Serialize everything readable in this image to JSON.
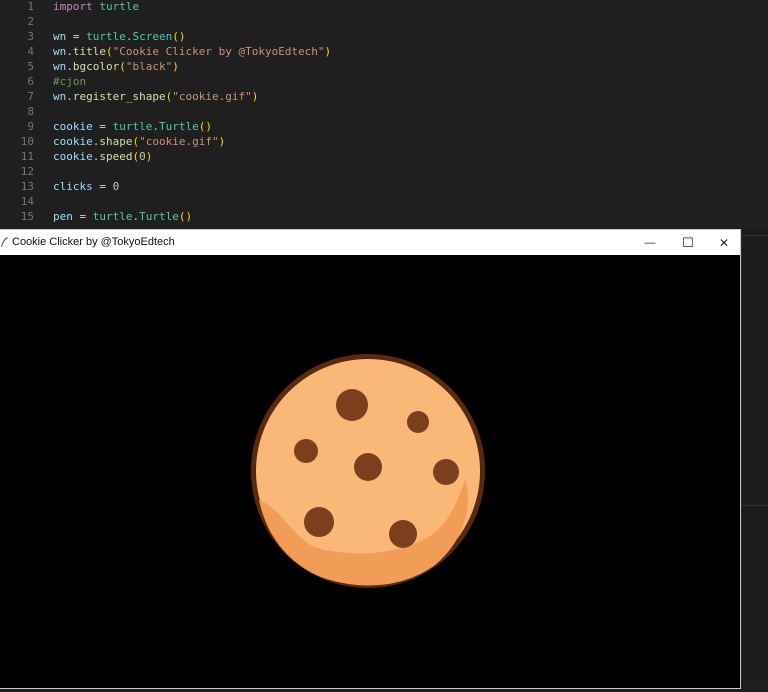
{
  "editor": {
    "lines": [
      {
        "n": "1",
        "tokens": [
          {
            "c": "kw",
            "t": "import"
          },
          {
            "c": "code",
            "t": " "
          },
          {
            "c": "mod",
            "t": "turtle"
          }
        ]
      },
      {
        "n": "2",
        "tokens": []
      },
      {
        "n": "3",
        "tokens": [
          {
            "c": "var",
            "t": "wn"
          },
          {
            "c": "op",
            "t": " = "
          },
          {
            "c": "mod",
            "t": "turtle"
          },
          {
            "c": "code",
            "t": "."
          },
          {
            "c": "mod",
            "t": "Screen"
          },
          {
            "c": "pn",
            "t": "()"
          }
        ]
      },
      {
        "n": "4",
        "tokens": [
          {
            "c": "var",
            "t": "wn"
          },
          {
            "c": "code",
            "t": "."
          },
          {
            "c": "fn",
            "t": "title"
          },
          {
            "c": "pn",
            "t": "("
          },
          {
            "c": "str",
            "t": "\"Cookie Clicker by @TokyoEdtech\""
          },
          {
            "c": "pn",
            "t": ")"
          }
        ]
      },
      {
        "n": "5",
        "tokens": [
          {
            "c": "var",
            "t": "wn"
          },
          {
            "c": "code",
            "t": "."
          },
          {
            "c": "fn",
            "t": "bgcolor"
          },
          {
            "c": "pn",
            "t": "("
          },
          {
            "c": "str",
            "t": "\"black\""
          },
          {
            "c": "pn",
            "t": ")"
          }
        ]
      },
      {
        "n": "6",
        "tokens": [
          {
            "c": "cm",
            "t": "#cjon"
          }
        ]
      },
      {
        "n": "7",
        "tokens": [
          {
            "c": "var",
            "t": "wn"
          },
          {
            "c": "code",
            "t": "."
          },
          {
            "c": "fn",
            "t": "register_shape"
          },
          {
            "c": "pn",
            "t": "("
          },
          {
            "c": "str",
            "t": "\"cookie.gif\""
          },
          {
            "c": "pn",
            "t": ")"
          }
        ]
      },
      {
        "n": "8",
        "tokens": []
      },
      {
        "n": "9",
        "tokens": [
          {
            "c": "var",
            "t": "cookie"
          },
          {
            "c": "op",
            "t": " = "
          },
          {
            "c": "mod",
            "t": "turtle"
          },
          {
            "c": "code",
            "t": "."
          },
          {
            "c": "mod",
            "t": "Turtle"
          },
          {
            "c": "pn",
            "t": "()"
          }
        ]
      },
      {
        "n": "10",
        "tokens": [
          {
            "c": "var",
            "t": "cookie"
          },
          {
            "c": "code",
            "t": "."
          },
          {
            "c": "fn",
            "t": "shape"
          },
          {
            "c": "pn",
            "t": "("
          },
          {
            "c": "str",
            "t": "\"cookie.gif\""
          },
          {
            "c": "pn",
            "t": ")"
          }
        ]
      },
      {
        "n": "11",
        "tokens": [
          {
            "c": "var",
            "t": "cookie"
          },
          {
            "c": "code",
            "t": "."
          },
          {
            "c": "fn",
            "t": "speed"
          },
          {
            "c": "pn",
            "t": "("
          },
          {
            "c": "num",
            "t": "0"
          },
          {
            "c": "pn",
            "t": ")"
          }
        ]
      },
      {
        "n": "12",
        "tokens": []
      },
      {
        "n": "13",
        "tokens": [
          {
            "c": "var",
            "t": "clicks"
          },
          {
            "c": "op",
            "t": " = "
          },
          {
            "c": "num",
            "t": "0"
          }
        ]
      },
      {
        "n": "14",
        "tokens": []
      },
      {
        "n": "15",
        "tokens": [
          {
            "c": "var",
            "t": "pen"
          },
          {
            "c": "op",
            "t": " = "
          },
          {
            "c": "mod",
            "t": "turtle"
          },
          {
            "c": "code",
            "t": "."
          },
          {
            "c": "mod",
            "t": "Turtle"
          },
          {
            "c": "pn",
            "t": "()"
          }
        ]
      }
    ]
  },
  "turtle_window": {
    "title": "Cookie Clicker by @TokyoEdtech",
    "minimize_glyph": "—",
    "maximize_glyph": "☐",
    "close_glyph": "✕",
    "icon": "feather-icon",
    "canvas_bg": "#000000"
  },
  "cookie": {
    "icon": "cookie-icon",
    "dough_color": "#f9b878",
    "outline_color": "#5a2a10",
    "chip_color": "#7b3f1e",
    "shadow_color": "#f19d57"
  }
}
